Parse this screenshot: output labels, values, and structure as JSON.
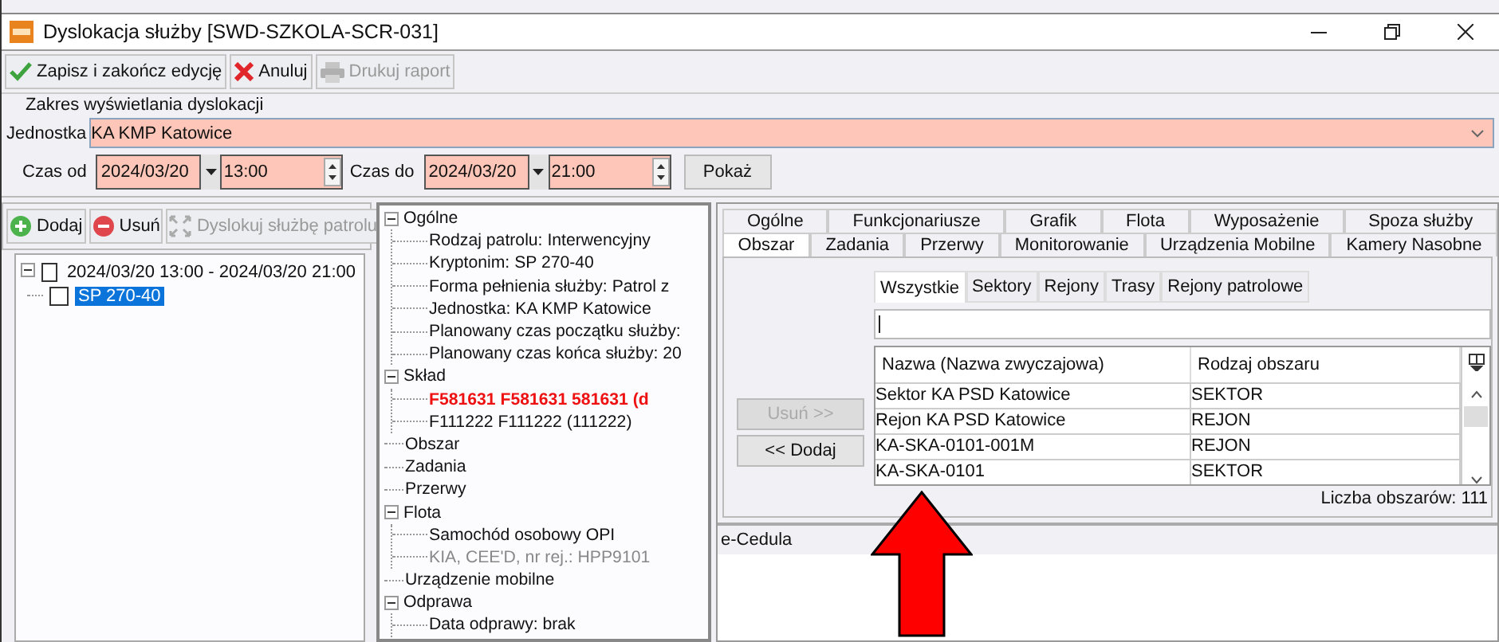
{
  "window": {
    "title": "Dyslokacja służby [SWD-SZKOLA-SCR-031]"
  },
  "toolbar": [
    {
      "label": "Zapisz i zakończ edycję",
      "disabled": false
    },
    {
      "label": "Anuluj",
      "disabled": false
    },
    {
      "label": "Drukuj raport",
      "disabled": true
    }
  ],
  "range": {
    "legend": "Zakres wyświetlania dyslokacji",
    "unit_label": "Jednostka",
    "unit_value": "KA KMP Katowice",
    "from_label": "Czas od",
    "from_date": "2024/03/20",
    "from_time": "13:00",
    "to_label": "Czas do",
    "to_date": "2024/03/20",
    "to_time": "21:00",
    "show_button": "Pokaż"
  },
  "left_panel": {
    "buttons": [
      {
        "label": "Dodaj",
        "disabled": false
      },
      {
        "label": "Usuń",
        "disabled": false
      },
      {
        "label": "Dyslokuj służbę patrolu",
        "disabled": true
      }
    ],
    "tree": [
      {
        "label": "2024/03/20 13:00 - 2024/03/20 21:00",
        "checked": false,
        "selected": false,
        "expanded": true,
        "children": [
          {
            "label": "SP 270-40",
            "checked": false,
            "selected": true
          }
        ]
      }
    ]
  },
  "details_tree": [
    {
      "label": "Ogólne",
      "expanded": true,
      "children": [
        {
          "label": "Rodzaj patrolu: Interwencyjny",
          "kind": "normal"
        },
        {
          "label": "Kryptonim: SP 270-40",
          "kind": "normal"
        },
        {
          "label": "Forma pełnienia służby: Patrol z",
          "kind": "normal"
        },
        {
          "label": "Jednostka: KA KMP Katowice",
          "kind": "normal"
        },
        {
          "label": "Planowany czas początku służby:",
          "kind": "normal"
        },
        {
          "label": "Planowany czas końca służby: 20",
          "kind": "normal"
        }
      ]
    },
    {
      "label": "Skład",
      "expanded": true,
      "children": [
        {
          "label": "F581631 F581631 581631 (d",
          "kind": "alert"
        },
        {
          "label": "F111222 F111222 (111222)",
          "kind": "normal"
        }
      ]
    },
    {
      "label": "Obszar"
    },
    {
      "label": "Zadania"
    },
    {
      "label": "Przerwy"
    },
    {
      "label": "Flota",
      "expanded": true,
      "children": [
        {
          "label": "Samochód osobowy OPI",
          "kind": "normal"
        },
        {
          "label": "KIA, CEE'D, nr rej.: HPP9101",
          "kind": "muted"
        }
      ]
    },
    {
      "label": "Urządzenie mobilne"
    },
    {
      "label": "Odprawa",
      "expanded": true,
      "children": [
        {
          "label": "Data odprawy: brak",
          "kind": "normal"
        }
      ]
    }
  ],
  "tabs": [
    [
      {
        "label": "Ogólne",
        "selected": false
      },
      {
        "label": "Funkcjonariusze",
        "selected": false
      },
      {
        "label": "Grafik",
        "selected": false
      },
      {
        "label": "Flota",
        "selected": false
      },
      {
        "label": "Wyposażenie",
        "selected": false
      },
      {
        "label": "Spoza służby",
        "selected": false
      }
    ],
    [
      {
        "label": "Obszar",
        "selected": true
      },
      {
        "label": "Zadania",
        "selected": false
      },
      {
        "label": "Przerwy",
        "selected": false
      },
      {
        "label": "Monitorowanie",
        "selected": false
      },
      {
        "label": "Urządzenia Mobilne",
        "selected": false
      },
      {
        "label": "Kamery Nasobne",
        "selected": false
      }
    ]
  ],
  "area": {
    "buttons": [
      {
        "label": "Usuń >>",
        "disabled": true
      },
      {
        "label": "<< Dodaj",
        "disabled": false
      }
    ],
    "subtabs": [
      {
        "label": "Wszystkie",
        "selected": true
      },
      {
        "label": "Sektory",
        "selected": false
      },
      {
        "label": "Rejony",
        "selected": false
      },
      {
        "label": "Trasy",
        "selected": false
      },
      {
        "label": "Rejony patrolowe",
        "selected": false
      }
    ],
    "table": {
      "columns": [
        "Nazwa (Nazwa zwyczajowa)",
        "Rodzaj obszaru"
      ],
      "rows": [
        [
          "Sektor KA PSD Katowice",
          "SEKTOR"
        ],
        [
          "Rejon KA PSD Katowice",
          "REJON"
        ],
        [
          "KA-SKA-0101-001M",
          "REJON"
        ],
        [
          "KA-SKA-0101",
          "SEKTOR"
        ]
      ]
    },
    "count": "Liczba obszarów: 111"
  },
  "bottom_panel": {
    "title": "e-Cedula"
  }
}
